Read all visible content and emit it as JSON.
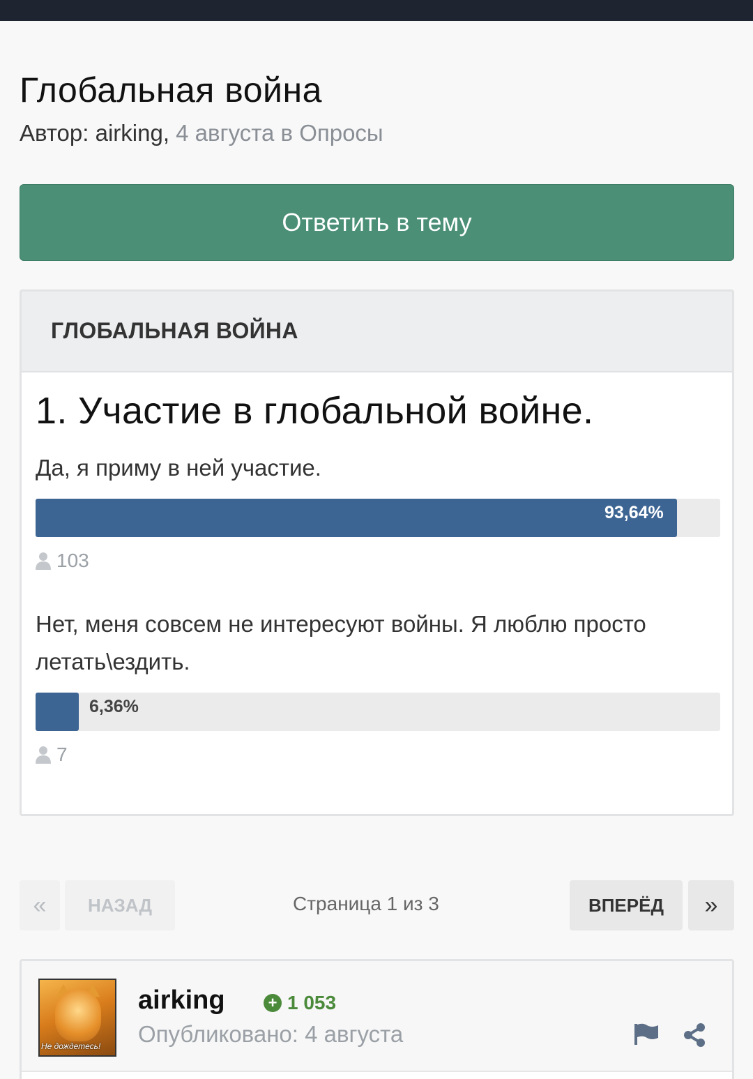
{
  "topic": {
    "title": "Глобальная война",
    "byline_prefix": "Автор: airking,",
    "byline_meta": "4 августа в Опросы"
  },
  "reply_button": "Ответить в тему",
  "poll": {
    "header": "ГЛОБАЛЬНАЯ ВОЙНА",
    "question": "1. Участие в глобальной войне.",
    "answers": [
      {
        "text": "Да, я приму в ней участие.",
        "percent_label": "93,64%",
        "fraction": 0.9364,
        "votes": "103"
      },
      {
        "text": "Нет, меня совсем не интересуют войны. Я люблю просто летать\\ездить.",
        "percent_label": "6,36%",
        "fraction": 0.0636,
        "votes": "7"
      }
    ],
    "bar_color": "#3d6594"
  },
  "pagination": {
    "first_icon": "double-chevron-left-icon",
    "prev_label": "НАЗАД",
    "info": "Страница 1 из 3",
    "next_label": "ВПЕРЁД",
    "last_icon": "double-chevron-right-icon"
  },
  "post": {
    "author": "airking",
    "reputation": "1 053",
    "posted": "Опубликовано: 4 августа",
    "avatar_caption": "Не дождетесь!",
    "accent_color": "#4b8a3a"
  }
}
